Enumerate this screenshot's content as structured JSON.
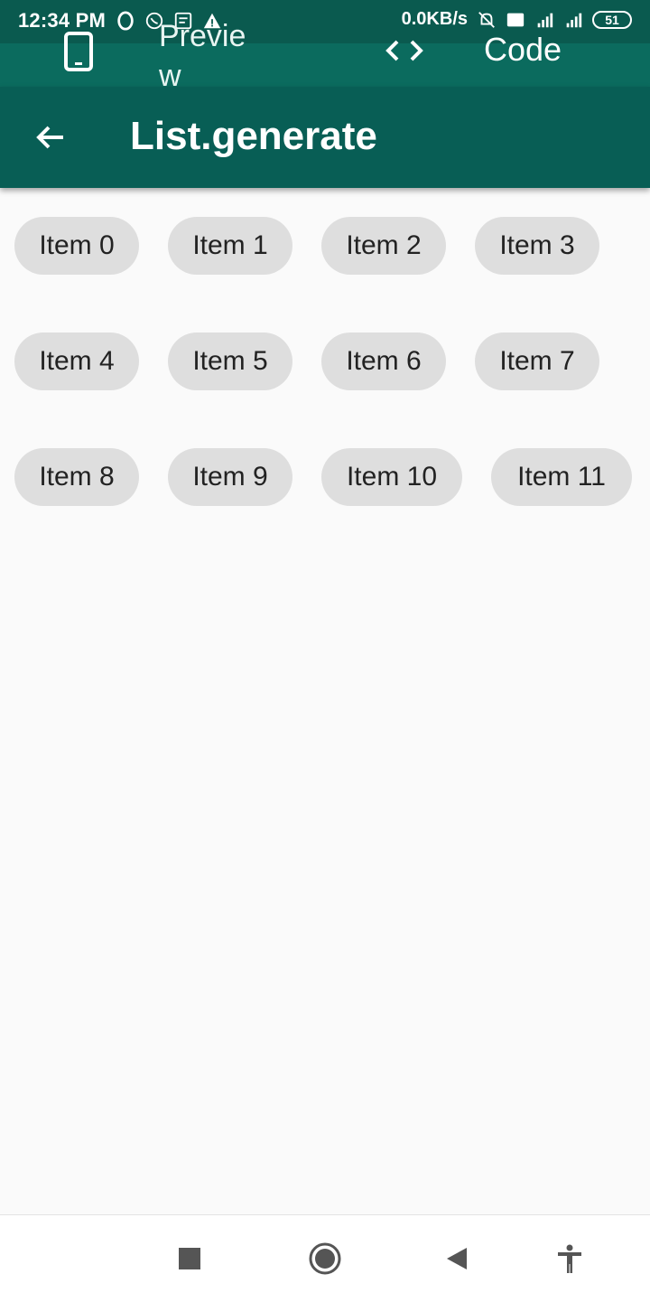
{
  "status_bar": {
    "time": "12:34 PM",
    "network_speed": "0.0KB/s",
    "battery": "51",
    "icons": [
      "opera-icon",
      "whatsapp-icon",
      "message-icon",
      "warning-icon",
      "mute-icon",
      "volte-icon",
      "signal-4g-icon",
      "signal-icon",
      "battery-icon"
    ]
  },
  "tabs": {
    "preview_label": "Previe w",
    "code_label": "Code"
  },
  "app_bar": {
    "title": "List.generate"
  },
  "chips": [
    [
      "Item 0",
      "Item 1",
      "Item 2",
      "Item 3"
    ],
    [
      "Item 4",
      "Item 5",
      "Item 6",
      "Item 7"
    ],
    [
      "Item 8",
      "Item 9",
      "Item 10",
      "Item 11"
    ]
  ],
  "navigation": {
    "icons": [
      "recents-square-icon",
      "home-circle-icon",
      "back-triangle-icon",
      "accessibility-icon"
    ]
  },
  "colors": {
    "status_bar": "#0a5a4f",
    "tabs_bar": "#0b6b5e",
    "app_bar": "#085e55",
    "chip_bg": "#dedede",
    "page_bg": "#fafafa"
  }
}
